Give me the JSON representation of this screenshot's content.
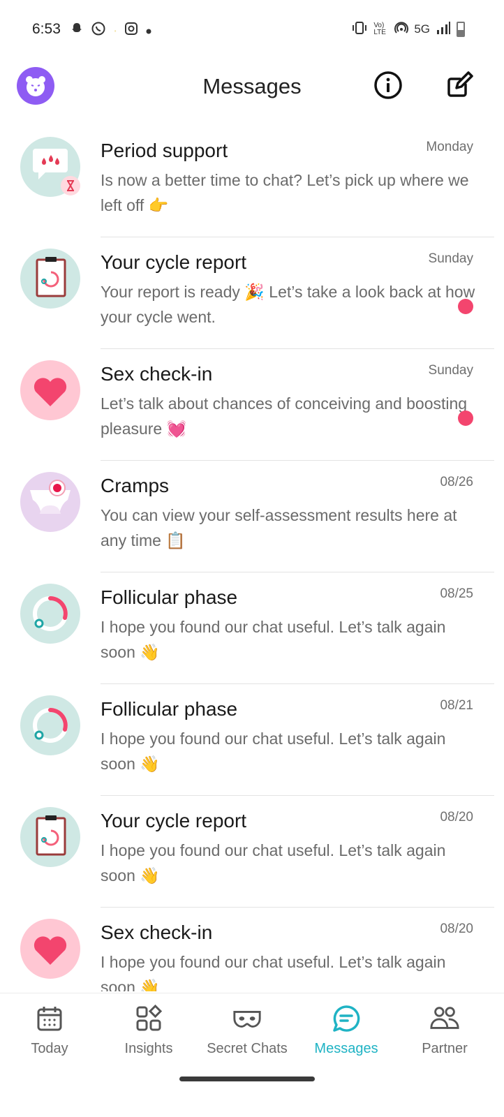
{
  "status_bar": {
    "time": "6:53",
    "network": "5G",
    "volte": "Vo) LTE"
  },
  "header": {
    "title": "Messages"
  },
  "messages": [
    {
      "title": "Period support",
      "date": "Monday",
      "preview": "Is now a better time to chat? Let’s pick up where we left off 👉",
      "icon": "period-support-icon",
      "icon_bg": "#cfe8e4",
      "unread": false
    },
    {
      "title": "Your cycle report",
      "date": "Sunday",
      "preview": "Your report is ready 🎉 Let’s take a look back at how your cycle went.",
      "icon": "cycle-report-icon",
      "icon_bg": "#cfe8e4",
      "unread": true
    },
    {
      "title": "Sex check-in",
      "date": "Sunday",
      "preview": "Let’s talk about chances of conceiving and boosting pleasure 💓",
      "icon": "heart-icon",
      "icon_bg": "#ffc7d3",
      "unread": true
    },
    {
      "title": "Cramps",
      "date": "08/26",
      "preview": "You can view your self-assessment results here at any time 📋",
      "icon": "cramps-icon",
      "icon_bg": "#e8d4ef",
      "unread": false
    },
    {
      "title": "Follicular phase",
      "date": "08/25",
      "preview": "I hope you found our chat useful. Let’s talk again soon 👋",
      "icon": "follicular-phase-icon",
      "icon_bg": "#cfe8e4",
      "unread": false
    },
    {
      "title": "Follicular phase",
      "date": "08/21",
      "preview": "I hope you found our chat useful. Let’s talk again soon 👋",
      "icon": "follicular-phase-icon",
      "icon_bg": "#cfe8e4",
      "unread": false
    },
    {
      "title": "Your cycle report",
      "date": "08/20",
      "preview": "I hope you found our chat useful. Let’s talk again soon 👋",
      "icon": "cycle-report-icon",
      "icon_bg": "#cfe8e4",
      "unread": false
    },
    {
      "title": "Sex check-in",
      "date": "08/20",
      "preview": "I hope you found our chat useful. Let’s talk again soon 👋",
      "icon": "heart-icon",
      "icon_bg": "#ffc7d3",
      "unread": false
    }
  ],
  "nav": {
    "today": "Today",
    "insights": "Insights",
    "secret_chats": "Secret Chats",
    "messages": "Messages",
    "partner": "Partner",
    "active": "messages",
    "active_color": "#1fb3c4"
  },
  "colors": {
    "accent": "#1fb3c4",
    "unread_dot": "#f3456e",
    "avatar_bg": "#8e5cf3"
  }
}
